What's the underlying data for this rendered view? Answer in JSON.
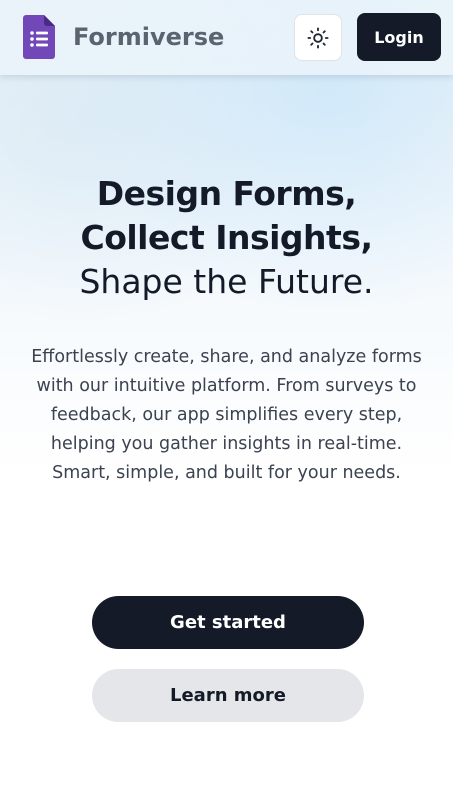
{
  "header": {
    "brand_name": "Formiverse",
    "brand_icon": "form-document-icon",
    "theme_toggle_icon": "sun-icon",
    "login_label": "Login"
  },
  "hero": {
    "title_line1": "Design Forms,",
    "title_line2": "Collect Insights,",
    "title_line3": "Shape the Future.",
    "description": "Effortlessly create, share, and analyze forms with our intuitive platform. From surveys to feedback, our app simplifies every step, helping you gather insights in real-time. Smart, simple, and built for your needs.",
    "primary_cta": "Get started",
    "secondary_cta": "Learn more"
  },
  "colors": {
    "brand_purple": "#7248b9",
    "dark": "#141a28",
    "secondary_button": "#e5e6e9"
  }
}
